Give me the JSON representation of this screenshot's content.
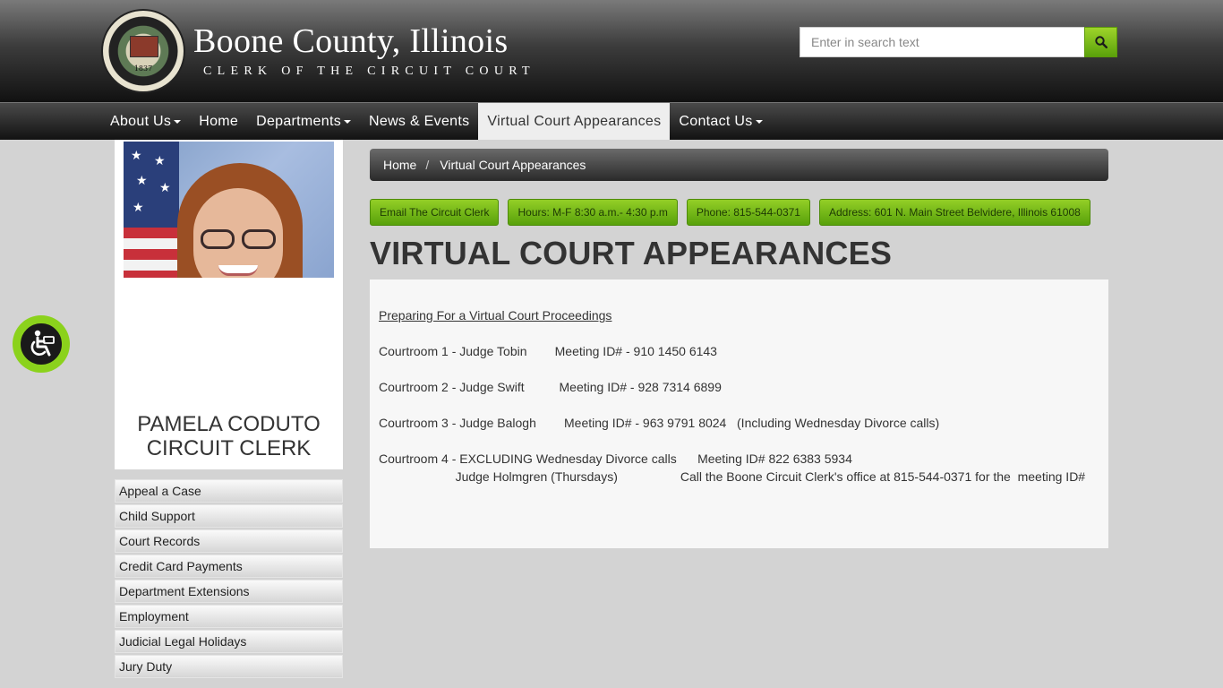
{
  "header": {
    "seal_year": "1837",
    "title": "Boone County, Illinois",
    "subtitle": "CLERK OF THE CIRCUIT COURT",
    "search_placeholder": "Enter in search text"
  },
  "nav": {
    "items": [
      {
        "label": "About Us",
        "dropdown": true
      },
      {
        "label": "Home",
        "dropdown": false
      },
      {
        "label": "Departments",
        "dropdown": true
      },
      {
        "label": "News & Events",
        "dropdown": false
      },
      {
        "label": "Virtual Court Appearances",
        "dropdown": false,
        "active": true
      },
      {
        "label": "Contact Us",
        "dropdown": true
      }
    ]
  },
  "sidebar": {
    "name_line1": "PAMELA CODUTO",
    "name_line2": "CIRCUIT CLERK",
    "menu": [
      "Appeal a Case",
      "Child Support",
      "Court Records",
      "Credit Card Payments",
      "Department Extensions",
      "Employment",
      "Judicial Legal Holidays",
      "Jury Duty"
    ]
  },
  "breadcrumb": {
    "home": "Home",
    "separator": "/",
    "current": "Virtual Court Appearances"
  },
  "info_buttons": [
    "Email The Circuit Clerk",
    "Hours: M-F 8:30 a.m.- 4:30 p.m",
    "Phone: 815-544-0371",
    "Address: 601 N. Main Street Belvidere, Illinois 61008"
  ],
  "page": {
    "title": "VIRTUAL COURT APPEARANCES",
    "link": "Preparing For a Virtual Court Proceedings",
    "lines": [
      "Courtroom 1 - Judge Tobin        Meeting ID# - 910 1450 6143",
      "Courtroom 2 - Judge Swift          Meeting ID# - 928 7314 6899",
      "Courtroom 3 - Judge Balogh        Meeting ID# - 963 9791 8024   (Including Wednesday Divorce calls)",
      "Courtroom 4 - EXCLUDING Wednesday Divorce calls      Meeting ID# 822 6383 5934",
      "                      Judge Holmgren (Thursdays)                  Call the Boone Circuit Clerk's office at 815-544-0371 for the  meeting ID#"
    ]
  },
  "colors": {
    "accent_green": "#7ec01a",
    "link": "#1a3a8a"
  },
  "icons": {
    "search": "search-icon",
    "accessibility": "accessibility-icon"
  }
}
